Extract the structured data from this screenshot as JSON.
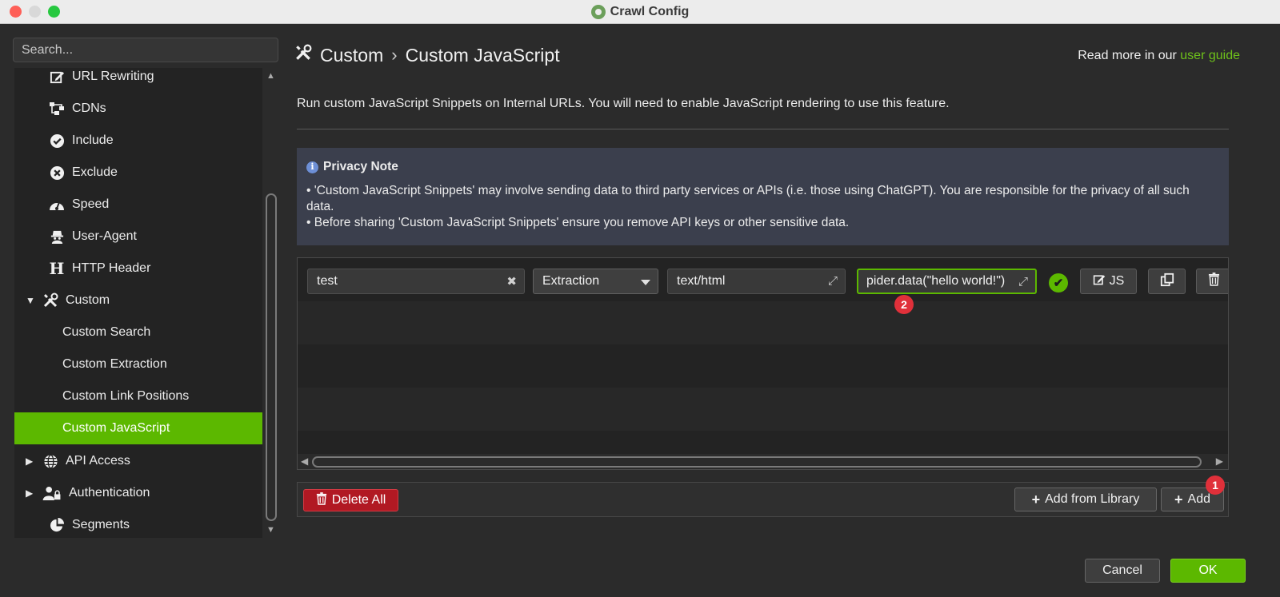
{
  "window": {
    "title": "Crawl Config"
  },
  "sidebar": {
    "search_placeholder": "Search...",
    "items": [
      {
        "label": "URL Rewriting",
        "icon": "edit-icon"
      },
      {
        "label": "CDNs",
        "icon": "network-icon"
      },
      {
        "label": "Include",
        "icon": "check-circle-icon"
      },
      {
        "label": "Exclude",
        "icon": "x-circle-icon"
      },
      {
        "label": "Speed",
        "icon": "gauge-icon"
      },
      {
        "label": "User-Agent",
        "icon": "spy-icon"
      },
      {
        "label": "HTTP Header",
        "icon": "h-icon"
      },
      {
        "label": "Custom",
        "icon": "tools-icon",
        "expanded": true
      },
      {
        "label": "Custom Search"
      },
      {
        "label": "Custom Extraction"
      },
      {
        "label": "Custom Link Positions"
      },
      {
        "label": "Custom JavaScript",
        "selected": true
      },
      {
        "label": "API Access",
        "icon": "globe-icon",
        "collapsed": true
      },
      {
        "label": "Authentication",
        "icon": "user-lock-icon",
        "collapsed": true
      },
      {
        "label": "Segments",
        "icon": "pie-icon"
      }
    ]
  },
  "header": {
    "crumb_parent": "Custom",
    "crumb_separator": "›",
    "crumb_current": "Custom JavaScript",
    "read_more_prefix": "Read more in our ",
    "read_more_link": "user guide"
  },
  "description": "Run custom JavaScript Snippets on Internal URLs. You will need to enable JavaScript rendering to use this feature.",
  "privacy_note": {
    "title": "Privacy Note",
    "line1": "• 'Custom JavaScript Snippets' may involve sending data to third party services or APIs (i.e. those using ChatGPT). You are responsible for the privacy of all such data.",
    "line2": "• Before sharing 'Custom JavaScript Snippets' ensure you remove API keys or other sensitive data."
  },
  "snippet_row": {
    "name": "test",
    "type": "Extraction",
    "content_type": "text/html",
    "javascript": "pider.data(\"hello world!\")",
    "js_button": "JS"
  },
  "badges": {
    "one": "1",
    "two": "2"
  },
  "footer": {
    "delete_all": "Delete All",
    "add_from_library": "Add from Library",
    "add": "Add"
  },
  "dialog": {
    "cancel": "Cancel",
    "ok": "OK"
  },
  "colors": {
    "accent": "#5cb800",
    "danger": "#b11923",
    "badge": "#e0303a",
    "note_bg": "#3b3f4d"
  }
}
